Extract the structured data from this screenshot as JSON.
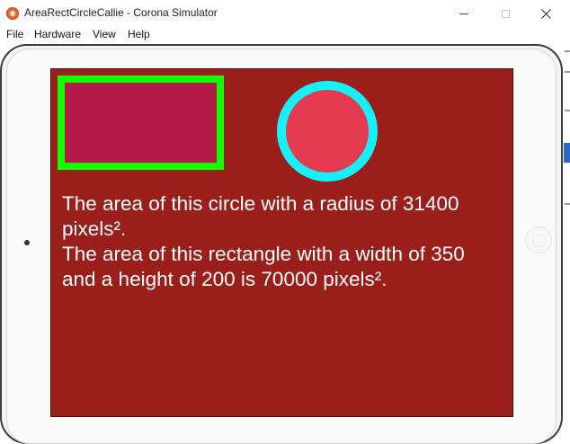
{
  "window": {
    "title": "AreaRectCircleCallie - Corona Simulator"
  },
  "menu": {
    "items": [
      "File",
      "Hardware",
      "View",
      "Help"
    ]
  },
  "app": {
    "background_color": "#9a1f1b",
    "rectangle": {
      "fill_color": "#b31a49",
      "stroke_color": "#12ff00"
    },
    "circle": {
      "fill_color": "#e43a50",
      "stroke_color": "#16f0f8"
    },
    "circle_text": "The area of this circle with a radius of 31400 pixels².",
    "rect_text": "The area of this rectangle with a width of 350 and a height of 200 is 70000 pixels²."
  },
  "icons": {
    "app": "corona-app-icon",
    "minimize": "minimize-icon",
    "maximize": "maximize-icon",
    "close": "close-icon",
    "camera": "camera-icon",
    "home": "home-button-icon"
  }
}
